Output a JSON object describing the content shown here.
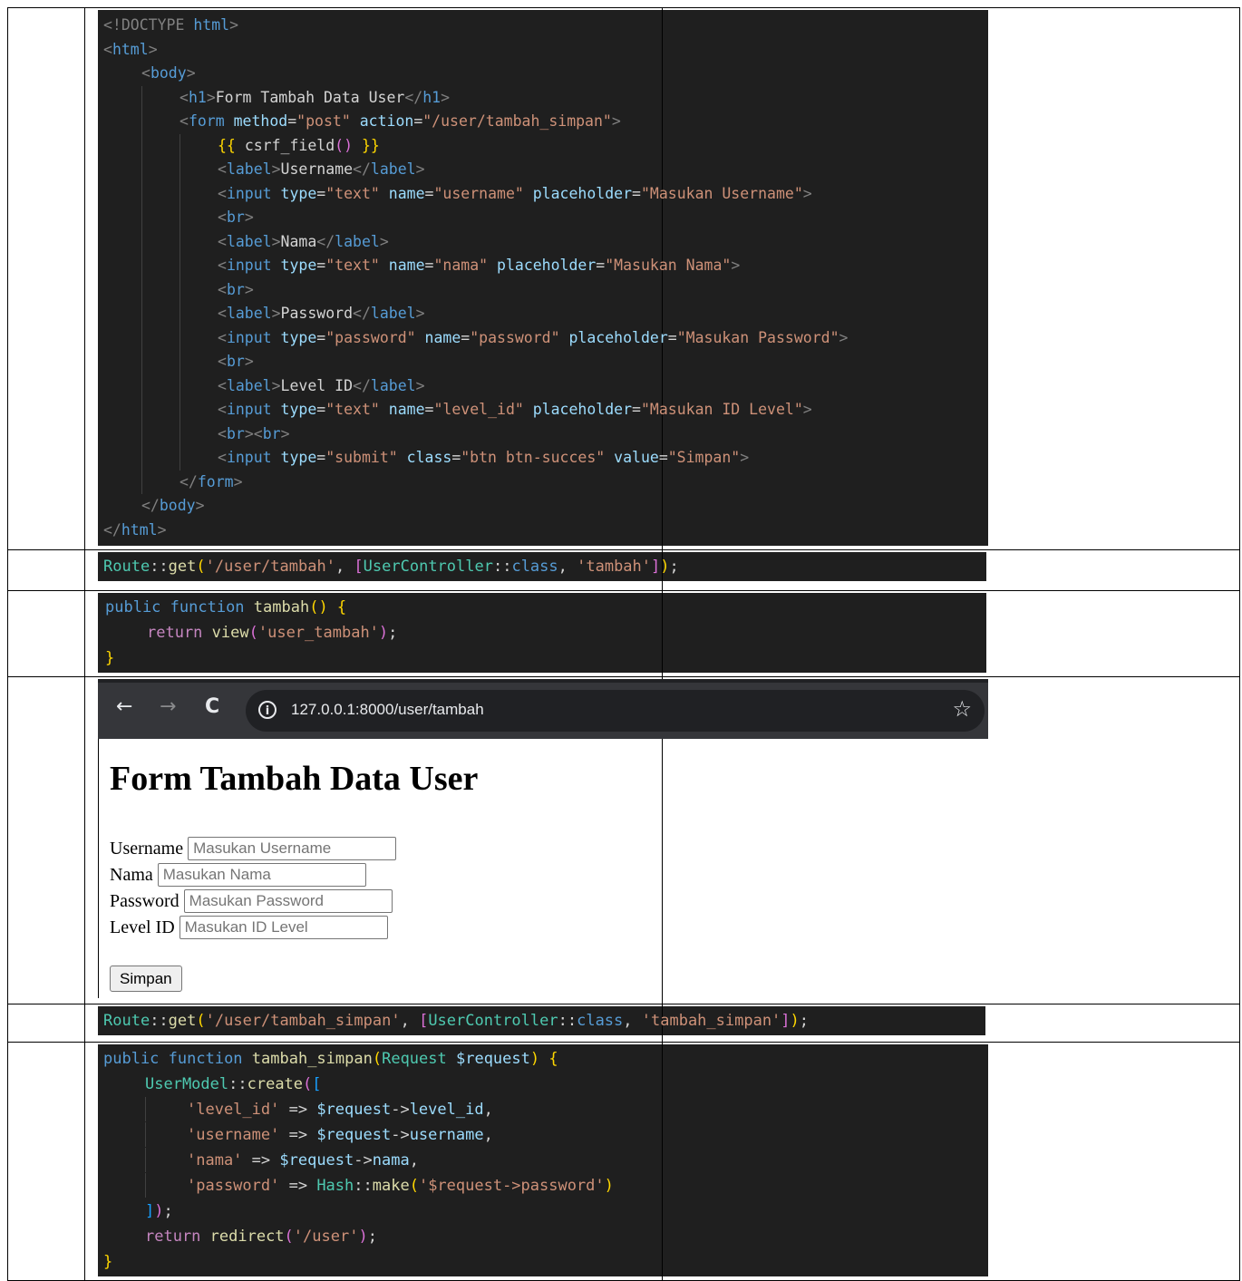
{
  "view_code": [
    {
      "indent": 0,
      "tokens": [
        [
          "t-br",
          "<!DOCTYPE "
        ],
        [
          "t-kw2",
          "html"
        ],
        [
          "t-br",
          ">"
        ]
      ]
    },
    {
      "indent": 0,
      "tokens": [
        [
          "t-br",
          "<"
        ],
        [
          "t-tag",
          "html"
        ],
        [
          "t-br",
          ">"
        ]
      ]
    },
    {
      "indent": 1,
      "tokens": [
        [
          "t-br",
          "<"
        ],
        [
          "t-tag",
          "body"
        ],
        [
          "t-br",
          ">"
        ]
      ]
    },
    {
      "indent": 2,
      "tokens": [
        [
          "t-br",
          "<"
        ],
        [
          "t-tag",
          "h1"
        ],
        [
          "t-br",
          ">"
        ],
        [
          "t-txt",
          "Form Tambah Data User"
        ],
        [
          "t-br",
          "</"
        ],
        [
          "t-tag",
          "h1"
        ],
        [
          "t-br",
          ">"
        ]
      ]
    },
    {
      "indent": 2,
      "tokens": [
        [
          "t-br",
          "<"
        ],
        [
          "t-tag",
          "form "
        ],
        [
          "t-attr",
          "method"
        ],
        [
          "t-txt",
          "="
        ],
        [
          "t-str",
          "\"post\" "
        ],
        [
          "t-attr",
          "action"
        ],
        [
          "t-txt",
          "="
        ],
        [
          "t-str",
          "\"/user/tambah_simpan\""
        ],
        [
          "t-br",
          ">"
        ]
      ]
    },
    {
      "indent": 3,
      "tokens": [
        [
          "t-brace",
          "{{ "
        ],
        [
          "t-txt",
          "csrf_field"
        ],
        [
          "t-pink",
          "()"
        ],
        [
          "t-brace",
          " }}"
        ]
      ]
    },
    {
      "indent": 3,
      "tokens": [
        [
          "t-br",
          "<"
        ],
        [
          "t-tag",
          "label"
        ],
        [
          "t-br",
          ">"
        ],
        [
          "t-txt",
          "Username"
        ],
        [
          "t-br",
          "</"
        ],
        [
          "t-tag",
          "label"
        ],
        [
          "t-br",
          ">"
        ]
      ]
    },
    {
      "indent": 3,
      "tokens": [
        [
          "t-br",
          "<"
        ],
        [
          "t-tag",
          "input "
        ],
        [
          "t-attr",
          "type"
        ],
        [
          "t-txt",
          "="
        ],
        [
          "t-str",
          "\"text\" "
        ],
        [
          "t-attr",
          "name"
        ],
        [
          "t-txt",
          "="
        ],
        [
          "t-str",
          "\"username\" "
        ],
        [
          "t-attr",
          "placeholder"
        ],
        [
          "t-txt",
          "="
        ],
        [
          "t-str",
          "\"Masukan Username\""
        ],
        [
          "t-br",
          ">"
        ]
      ]
    },
    {
      "indent": 3,
      "tokens": [
        [
          "t-br",
          "<"
        ],
        [
          "t-tag",
          "br"
        ],
        [
          "t-br",
          ">"
        ]
      ]
    },
    {
      "indent": 3,
      "tokens": [
        [
          "t-br",
          "<"
        ],
        [
          "t-tag",
          "label"
        ],
        [
          "t-br",
          ">"
        ],
        [
          "t-txt",
          "Nama"
        ],
        [
          "t-br",
          "</"
        ],
        [
          "t-tag",
          "label"
        ],
        [
          "t-br",
          ">"
        ]
      ]
    },
    {
      "indent": 3,
      "tokens": [
        [
          "t-br",
          "<"
        ],
        [
          "t-tag",
          "input "
        ],
        [
          "t-attr",
          "type"
        ],
        [
          "t-txt",
          "="
        ],
        [
          "t-str",
          "\"text\" "
        ],
        [
          "t-attr",
          "name"
        ],
        [
          "t-txt",
          "="
        ],
        [
          "t-str",
          "\"nama\" "
        ],
        [
          "t-attr",
          "placeholder"
        ],
        [
          "t-txt",
          "="
        ],
        [
          "t-str",
          "\"Masukan Nama\""
        ],
        [
          "t-br",
          ">"
        ]
      ]
    },
    {
      "indent": 3,
      "tokens": [
        [
          "t-br",
          "<"
        ],
        [
          "t-tag",
          "br"
        ],
        [
          "t-br",
          ">"
        ]
      ]
    },
    {
      "indent": 3,
      "tokens": [
        [
          "t-br",
          "<"
        ],
        [
          "t-tag",
          "label"
        ],
        [
          "t-br",
          ">"
        ],
        [
          "t-txt",
          "Password"
        ],
        [
          "t-br",
          "</"
        ],
        [
          "t-tag",
          "label"
        ],
        [
          "t-br",
          ">"
        ]
      ]
    },
    {
      "indent": 3,
      "tokens": [
        [
          "t-br",
          "<"
        ],
        [
          "t-tag",
          "input "
        ],
        [
          "t-attr",
          "type"
        ],
        [
          "t-txt",
          "="
        ],
        [
          "t-str",
          "\"password\" "
        ],
        [
          "t-attr",
          "name"
        ],
        [
          "t-txt",
          "="
        ],
        [
          "t-str",
          "\"password\" "
        ],
        [
          "t-attr",
          "placeholder"
        ],
        [
          "t-txt",
          "="
        ],
        [
          "t-str",
          "\"Masukan Password\""
        ],
        [
          "t-br",
          ">"
        ]
      ]
    },
    {
      "indent": 3,
      "tokens": [
        [
          "t-br",
          "<"
        ],
        [
          "t-tag",
          "br"
        ],
        [
          "t-br",
          ">"
        ]
      ]
    },
    {
      "indent": 3,
      "tokens": [
        [
          "t-br",
          "<"
        ],
        [
          "t-tag",
          "label"
        ],
        [
          "t-br",
          ">"
        ],
        [
          "t-txt",
          "Level ID"
        ],
        [
          "t-br",
          "</"
        ],
        [
          "t-tag",
          "label"
        ],
        [
          "t-br",
          ">"
        ]
      ]
    },
    {
      "indent": 3,
      "tokens": [
        [
          "t-br",
          "<"
        ],
        [
          "t-tag",
          "input "
        ],
        [
          "t-attr",
          "type"
        ],
        [
          "t-txt",
          "="
        ],
        [
          "t-str",
          "\"text\" "
        ],
        [
          "t-attr",
          "name"
        ],
        [
          "t-txt",
          "="
        ],
        [
          "t-str",
          "\"level_id\" "
        ],
        [
          "t-attr",
          "placeholder"
        ],
        [
          "t-txt",
          "="
        ],
        [
          "t-str",
          "\"Masukan ID Level\""
        ],
        [
          "t-br",
          ">"
        ]
      ]
    },
    {
      "indent": 3,
      "tokens": [
        [
          "t-br",
          "<"
        ],
        [
          "t-tag",
          "br"
        ],
        [
          "t-br",
          "><"
        ],
        [
          "t-tag",
          "br"
        ],
        [
          "t-br",
          ">"
        ]
      ]
    },
    {
      "indent": 3,
      "tokens": [
        [
          "t-br",
          "<"
        ],
        [
          "t-tag",
          "input "
        ],
        [
          "t-attr",
          "type"
        ],
        [
          "t-txt",
          "="
        ],
        [
          "t-str",
          "\"submit\" "
        ],
        [
          "t-attr",
          "class"
        ],
        [
          "t-txt",
          "="
        ],
        [
          "t-str",
          "\"btn btn-succes\" "
        ],
        [
          "t-attr",
          "value"
        ],
        [
          "t-txt",
          "="
        ],
        [
          "t-str",
          "\"Simpan\""
        ],
        [
          "t-br",
          ">"
        ]
      ]
    },
    {
      "indent": 2,
      "tokens": [
        [
          "t-br",
          "</"
        ],
        [
          "t-tag",
          "form"
        ],
        [
          "t-br",
          ">"
        ]
      ]
    },
    {
      "indent": 1,
      "tokens": [
        [
          "t-br",
          "</"
        ],
        [
          "t-tag",
          "body"
        ],
        [
          "t-br",
          ">"
        ]
      ]
    },
    {
      "indent": 0,
      "tokens": [
        [
          "t-br",
          "</"
        ],
        [
          "t-tag",
          "html"
        ],
        [
          "t-br",
          ">"
        ]
      ]
    }
  ],
  "route1_code": [
    {
      "indent": 0,
      "tokens": [
        [
          "t-cls",
          "Route"
        ],
        [
          "t-op",
          "::"
        ],
        [
          "t-fn",
          "get"
        ],
        [
          "t-brace",
          "("
        ],
        [
          "t-str",
          "'/user/tambah'"
        ],
        [
          "t-op",
          ", "
        ],
        [
          "t-pink",
          "["
        ],
        [
          "t-cls",
          "UserController"
        ],
        [
          "t-op",
          "::"
        ],
        [
          "t-kw2",
          "class"
        ],
        [
          "t-op",
          ", "
        ],
        [
          "t-str",
          "'tambah'"
        ],
        [
          "t-pink",
          "]"
        ],
        [
          "t-brace",
          ")"
        ],
        [
          "t-op",
          ";"
        ]
      ]
    }
  ],
  "controller1_code": [
    {
      "indent": 0,
      "tokens": [
        [
          "t-kw2",
          "public "
        ],
        [
          "t-kw2",
          "function "
        ],
        [
          "t-fn",
          "tambah"
        ],
        [
          "t-brace",
          "() {"
        ]
      ]
    },
    {
      "indent": 1,
      "tokens": [
        [
          "t-kw",
          "return "
        ],
        [
          "t-fn",
          "view"
        ],
        [
          "t-pink",
          "("
        ],
        [
          "t-str",
          "'user_tambah'"
        ],
        [
          "t-pink",
          ")"
        ],
        [
          "t-op",
          ";"
        ]
      ]
    },
    {
      "indent": 0,
      "tokens": [
        [
          "t-brace",
          "}"
        ]
      ]
    }
  ],
  "browser": {
    "url": "127.0.0.1:8000/user/tambah",
    "back_icon": "←",
    "forward_icon": "→",
    "reload_icon": "C",
    "info_icon": "i",
    "star_icon": "☆",
    "heading": "Form Tambah Data User",
    "fields": [
      {
        "label": "Username",
        "placeholder": "Masukan Username",
        "width": 230
      },
      {
        "label": "Nama",
        "placeholder": "Masukan Nama",
        "width": 230
      },
      {
        "label": "Password",
        "placeholder": "Masukan Password",
        "width": 230
      },
      {
        "label": "Level ID",
        "placeholder": "Masukan ID Level",
        "width": 230
      }
    ],
    "submit_label": "Simpan"
  },
  "route2_code": [
    {
      "indent": 0,
      "tokens": [
        [
          "t-cls",
          "Route"
        ],
        [
          "t-op",
          "::"
        ],
        [
          "t-fn",
          "get"
        ],
        [
          "t-brace",
          "("
        ],
        [
          "t-str",
          "'/user/tambah_simpan'"
        ],
        [
          "t-op",
          ", "
        ],
        [
          "t-pink",
          "["
        ],
        [
          "t-cls",
          "UserController"
        ],
        [
          "t-op",
          "::"
        ],
        [
          "t-kw2",
          "class"
        ],
        [
          "t-op",
          ", "
        ],
        [
          "t-str",
          "'tambah_simpan'"
        ],
        [
          "t-pink",
          "]"
        ],
        [
          "t-brace",
          ")"
        ],
        [
          "t-op",
          ";"
        ]
      ]
    }
  ],
  "controller2_code": [
    {
      "indent": 0,
      "tokens": [
        [
          "t-kw2",
          "public "
        ],
        [
          "t-kw2",
          "function "
        ],
        [
          "t-fn",
          "tambah_simpan"
        ],
        [
          "t-brace",
          "("
        ],
        [
          "t-cls",
          "Request "
        ],
        [
          "t-var",
          "$request"
        ],
        [
          "t-brace",
          ") {"
        ]
      ]
    },
    {
      "indent": 1,
      "tokens": [
        [
          "t-cls",
          "UserModel"
        ],
        [
          "t-op",
          "::"
        ],
        [
          "t-fn",
          "create"
        ],
        [
          "t-pink",
          "("
        ],
        [
          "t-blue",
          "["
        ]
      ]
    },
    {
      "indent": 2,
      "tokens": [
        [
          "t-str",
          "'level_id'"
        ],
        [
          "t-op",
          " => "
        ],
        [
          "t-var",
          "$request"
        ],
        [
          "t-op",
          "->"
        ],
        [
          "t-var",
          "level_id"
        ],
        [
          "t-op",
          ","
        ]
      ]
    },
    {
      "indent": 2,
      "tokens": [
        [
          "t-str",
          "'username'"
        ],
        [
          "t-op",
          " => "
        ],
        [
          "t-var",
          "$request"
        ],
        [
          "t-op",
          "->"
        ],
        [
          "t-var",
          "username"
        ],
        [
          "t-op",
          ","
        ]
      ]
    },
    {
      "indent": 2,
      "tokens": [
        [
          "t-str",
          "'nama'"
        ],
        [
          "t-op",
          " => "
        ],
        [
          "t-var",
          "$request"
        ],
        [
          "t-op",
          "->"
        ],
        [
          "t-var",
          "nama"
        ],
        [
          "t-op",
          ","
        ]
      ]
    },
    {
      "indent": 2,
      "tokens": [
        [
          "t-str",
          "'password'"
        ],
        [
          "t-op",
          " => "
        ],
        [
          "t-cls",
          "Hash"
        ],
        [
          "t-op",
          "::"
        ],
        [
          "t-fn",
          "make"
        ],
        [
          "t-brace",
          "("
        ],
        [
          "t-str",
          "'$request->password'"
        ],
        [
          "t-brace",
          ")"
        ]
      ]
    },
    {
      "indent": 1,
      "tokens": [
        [
          "t-blue",
          "]"
        ],
        [
          "t-pink",
          ")"
        ],
        [
          "t-op",
          ";"
        ]
      ]
    },
    {
      "indent": 1,
      "tokens": [
        [
          "t-kw",
          "return "
        ],
        [
          "t-fn",
          "redirect"
        ],
        [
          "t-pink",
          "("
        ],
        [
          "t-str",
          "'/user'"
        ],
        [
          "t-pink",
          ")"
        ],
        [
          "t-op",
          ";"
        ]
      ]
    },
    {
      "indent": 0,
      "tokens": [
        [
          "t-brace",
          "}"
        ]
      ]
    }
  ]
}
